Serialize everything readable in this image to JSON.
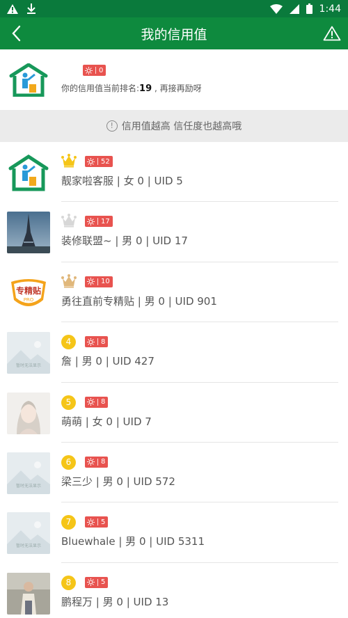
{
  "status_bar": {
    "time": "1:44"
  },
  "header": {
    "title": "我的信用值"
  },
  "me": {
    "badge_value": "0",
    "rank_prefix": "你的信用值当前排名:",
    "rank_value": "19",
    "rank_suffix": " , 再接再励呀"
  },
  "notice": {
    "text": "信用值越高 信任度也越高哦"
  },
  "placeholder_text": "暂时无法显示",
  "users": [
    {
      "rank": "1",
      "badge": "52",
      "name": "靓家啦客服",
      "gender": "女",
      "gender_value": "0",
      "uid": "UID 5",
      "avatar": "house-logo"
    },
    {
      "rank": "2",
      "badge": "17",
      "name": "装修联盟~",
      "gender": "男",
      "gender_value": "0",
      "uid": "UID 17",
      "avatar": "tower-photo"
    },
    {
      "rank": "3",
      "badge": "10",
      "name": "勇往直前专精贴",
      "gender": "男",
      "gender_value": "0",
      "uid": "UID 901",
      "avatar": "shield-logo"
    },
    {
      "rank": "4",
      "badge": "8",
      "name": "詹",
      "gender": "男",
      "gender_value": "0",
      "uid": "UID 427",
      "avatar": "placeholder"
    },
    {
      "rank": "5",
      "badge": "8",
      "name": "萌萌",
      "gender": "女",
      "gender_value": "0",
      "uid": "UID 7",
      "avatar": "girl-photo"
    },
    {
      "rank": "6",
      "badge": "8",
      "name": "梁三少",
      "gender": "男",
      "gender_value": "0",
      "uid": "UID 572",
      "avatar": "placeholder"
    },
    {
      "rank": "7",
      "badge": "5",
      "name": "Bluewhale",
      "gender": "男",
      "gender_value": "0",
      "uid": "UID 5311",
      "avatar": "placeholder"
    },
    {
      "rank": "8",
      "badge": "5",
      "name": "鹏程万",
      "gender": "男",
      "gender_value": "0",
      "uid": "UID 13",
      "avatar": "man-photo"
    }
  ],
  "colors": {
    "primary": "#0e8a3e",
    "badge": "#e8534f",
    "gold": "#f5c518"
  }
}
